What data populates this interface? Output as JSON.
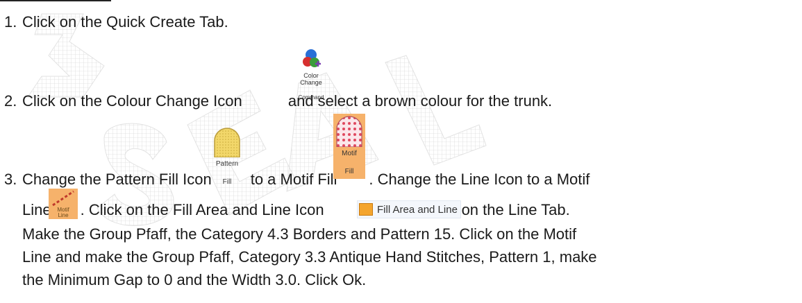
{
  "steps": {
    "s1": {
      "num": "1.",
      "text": "Click on the Quick Create Tab."
    },
    "s2": {
      "num": "2.",
      "text_a": "Click on the Colour Change Icon",
      "text_b": " and select a brown colour for the trunk."
    },
    "s3": {
      "num": "3.",
      "text_a": "Change the Pattern Fill Icon",
      "text_b": "to a Motif Fill",
      "text_c": ".  Change the Line Icon to a Motif",
      "line2_a": "Line",
      "line2_b": ".  Click on the Fill Area and Line Icon",
      "line2_c": ".  Click on the Line Tab.",
      "line3": "Make the Group Pfaff, the Category 4.3 Borders and Pattern 15.  Click on the Motif",
      "line4": "Line and make the Group Pfaff, Category 3.3 Antique Hand Stitches, Pattern 1, make",
      "line5": "the Minimum Gap to 0 and the Width 3.0.  Click Ok."
    }
  },
  "icons": {
    "color_change": {
      "name": "color-change-command-icon",
      "label_1": "Color",
      "label_2": "Change",
      "label_3": "Command"
    },
    "pattern_fill": {
      "name": "pattern-fill-icon",
      "label_1": "Pattern",
      "label_2": "Fill"
    },
    "motif_fill": {
      "name": "motif-fill-icon",
      "label_1": "Motif",
      "label_2": "Fill"
    },
    "motif_line": {
      "name": "motif-line-icon",
      "label_1": "Motif",
      "label_2": "Line"
    },
    "fill_area_line": {
      "name": "fill-area-and-line-icon",
      "label": "Fill Area and Line"
    }
  },
  "colors": {
    "motif_bg": "#f6b26b",
    "pattern_gold": "#f2d76a",
    "fill_area_orange": "#f4a52e"
  }
}
